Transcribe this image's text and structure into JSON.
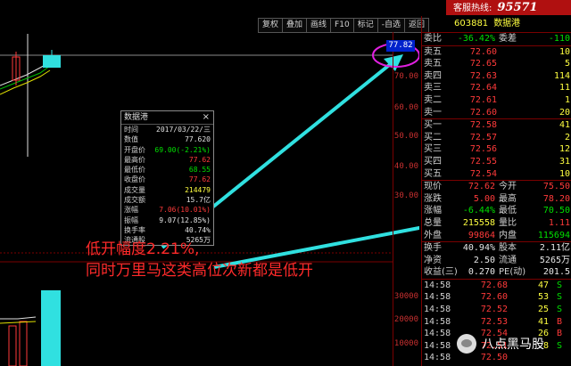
{
  "hotline": {
    "label": "客服热线:",
    "number": "95571"
  },
  "toolbar": [
    "复权",
    "叠加",
    "画线",
    "F10",
    "标记",
    "-自选",
    "返回"
  ],
  "chart": {
    "price_flag": "77.82",
    "y_ticks_price": [
      "70.00",
      "60.00",
      "50.00",
      "40.00",
      "30.00"
    ],
    "y_ticks_volume": [
      "30000",
      "20000",
      "10000"
    ]
  },
  "popup": {
    "title": "数据港",
    "close": "×",
    "rows": [
      {
        "k": "时间",
        "v": "2017/03/22/三",
        "color": "#e0e0e0"
      },
      {
        "k": "数值",
        "v": "77.620",
        "color": "#e0e0e0"
      },
      {
        "k": "开盘价",
        "v": "69.00(-2.21%)",
        "color": "#00e000"
      },
      {
        "k": "最高价",
        "v": "77.62",
        "color": "#ff3a3a"
      },
      {
        "k": "最低价",
        "v": "68.55",
        "color": "#00e000"
      },
      {
        "k": "收盘价",
        "v": "77.62",
        "color": "#ff3a3a"
      },
      {
        "k": "成交量",
        "v": "214479",
        "color": "#ffff40"
      },
      {
        "k": "成交额",
        "v": "15.7亿",
        "color": "#e0e0e0"
      },
      {
        "k": "涨幅",
        "v": "7.06(10.01%)",
        "color": "#ff3a3a"
      },
      {
        "k": "振幅",
        "v": "9.07(12.85%)",
        "color": "#e0e0e0"
      },
      {
        "k": "换手率",
        "v": "40.74%",
        "color": "#e0e0e0"
      },
      {
        "k": "流通股",
        "v": "5265万",
        "color": "#e0e0e0"
      }
    ]
  },
  "annotation": {
    "line1": "低开幅度2.21%,",
    "line2": "同时万里马这类高位次新都是低开"
  },
  "quote": {
    "code": "603881",
    "name": "数据港",
    "ratio": {
      "k": "委比",
      "v": "-36.42%",
      "k2": "委差",
      "v2": "-110"
    },
    "sells": [
      {
        "lb": "卖五",
        "p": "72.60",
        "v": "10"
      },
      {
        "lb": "卖五",
        "p": "72.65",
        "v": "5"
      },
      {
        "lb": "卖四",
        "p": "72.63",
        "v": "114"
      },
      {
        "lb": "卖三",
        "p": "72.64",
        "v": "11"
      },
      {
        "lb": "卖二",
        "p": "72.61",
        "v": "1"
      },
      {
        "lb": "卖一",
        "p": "72.60",
        "v": "20"
      }
    ],
    "buys": [
      {
        "lb": "买一",
        "p": "72.58",
        "v": "41"
      },
      {
        "lb": "买二",
        "p": "72.57",
        "v": "2"
      },
      {
        "lb": "买三",
        "p": "72.56",
        "v": "12"
      },
      {
        "lb": "买四",
        "p": "72.55",
        "v": "31"
      },
      {
        "lb": "买五",
        "p": "72.54",
        "v": "10"
      }
    ],
    "stats": [
      [
        {
          "k": "现价",
          "v": "72.62",
          "c": "#ff3a3a"
        },
        {
          "k": "今开",
          "v": "75.50",
          "c": "#ff3a3a"
        }
      ],
      [
        {
          "k": "涨跌",
          "v": "5.00",
          "c": "#ff3a3a"
        },
        {
          "k": "最高",
          "v": "78.20",
          "c": "#ff3a3a"
        }
      ],
      [
        {
          "k": "涨幅",
          "v": "-6.44%",
          "c": "#00e000"
        },
        {
          "k": "最低",
          "v": "70.50",
          "c": "#00e000"
        }
      ],
      [
        {
          "k": "总量",
          "v": "215558",
          "c": "#ffff40"
        },
        {
          "k": "量比",
          "v": "1.11",
          "c": "#ff3a3a"
        }
      ],
      [
        {
          "k": "外盘",
          "v": "99864",
          "c": "#ff3a3a"
        },
        {
          "k": "内盘",
          "v": "115694",
          "c": "#00e000"
        }
      ]
    ],
    "stats2": [
      [
        {
          "k": "换手",
          "v": "40.94%",
          "c": "#e8e8e8"
        },
        {
          "k": "股本",
          "v": "2.11亿",
          "c": "#e8e8e8"
        }
      ],
      [
        {
          "k": "净资",
          "v": "2.50",
          "c": "#e8e8e8"
        },
        {
          "k": "流通",
          "v": "5265万",
          "c": "#e8e8e8"
        }
      ],
      [
        {
          "k": "收益(三)",
          "v": "0.270",
          "c": "#e8e8e8"
        },
        {
          "k": "PE(动)",
          "v": "201.5",
          "c": "#e8e8e8"
        }
      ]
    ],
    "ticks": [
      {
        "t": "14:58",
        "p": "72.68",
        "v": "47",
        "s": "S",
        "sc": "#00e000"
      },
      {
        "t": "14:58",
        "p": "72.60",
        "v": "53",
        "s": "S",
        "sc": "#00e000"
      },
      {
        "t": "14:58",
        "p": "72.52",
        "v": "25",
        "s": "S",
        "sc": "#00e000"
      },
      {
        "t": "14:58",
        "p": "72.53",
        "v": "41",
        "s": "B",
        "sc": "#ff3a3a"
      },
      {
        "t": "14:58",
        "p": "72.54",
        "v": "26",
        "s": "B",
        "sc": "#ff3a3a"
      },
      {
        "t": "14:58",
        "p": "72.51",
        "v": "8",
        "s": "S",
        "sc": "#00e000"
      },
      {
        "t": "14:58",
        "p": "72.50",
        "v": "",
        "s": "",
        "sc": "#00e000"
      }
    ]
  },
  "watermark": "八点黑马股"
}
